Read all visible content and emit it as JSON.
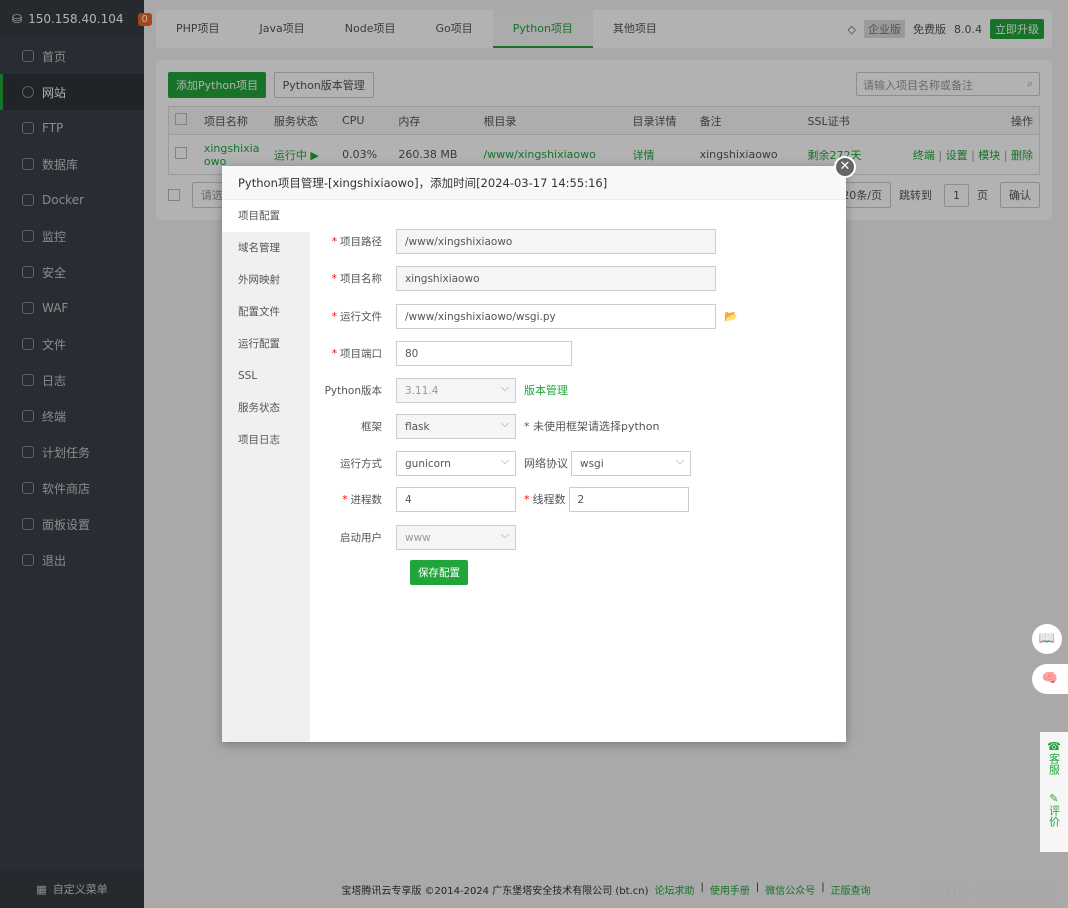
{
  "sidebar": {
    "ip": "150.158.40.104",
    "badge": "0",
    "items": [
      {
        "label": "首页",
        "icon": "home-icon"
      },
      {
        "label": "网站",
        "icon": "globe-icon",
        "active": true
      },
      {
        "label": "FTP",
        "icon": "ftp-icon"
      },
      {
        "label": "数据库",
        "icon": "database-icon"
      },
      {
        "label": "Docker",
        "icon": "docker-icon"
      },
      {
        "label": "监控",
        "icon": "monitor-icon"
      },
      {
        "label": "安全",
        "icon": "shield-icon"
      },
      {
        "label": "WAF",
        "icon": "waf-icon"
      },
      {
        "label": "文件",
        "icon": "folder-icon"
      },
      {
        "label": "日志",
        "icon": "log-icon"
      },
      {
        "label": "终端",
        "icon": "terminal-icon"
      },
      {
        "label": "计划任务",
        "icon": "calendar-icon"
      },
      {
        "label": "软件商店",
        "icon": "store-icon"
      },
      {
        "label": "面板设置",
        "icon": "gear-icon"
      },
      {
        "label": "退出",
        "icon": "logout-icon"
      }
    ],
    "footer": "自定义菜单"
  },
  "topbar": {
    "tabs": [
      "PHP项目",
      "Java项目",
      "Node项目",
      "Go项目",
      "Python项目",
      "其他项目"
    ],
    "active_tab": 4,
    "enterprise": "企业版",
    "edition": "免费版",
    "version": "8.0.4",
    "upgrade": "立即升级"
  },
  "panel": {
    "add_button": "添加Python项目",
    "version_button": "Python版本管理",
    "search_placeholder": "请输入项目名称或备注",
    "columns": [
      "项目名称",
      "服务状态",
      "CPU",
      "内存",
      "根目录",
      "目录详情",
      "备注",
      "SSL证书",
      "操作"
    ],
    "row": {
      "name": "xingshixiaowo",
      "status": "运行中 ▶",
      "cpu": "0.03%",
      "memory": "260.38 MB",
      "root": "/www/xingshixiaowo",
      "detail": "详情",
      "note": "xingshixiaowo",
      "ssl": "剩余272天",
      "actions": [
        "终端",
        "设置",
        "模块",
        "删除"
      ]
    },
    "batch_placeholder": "请选",
    "page_size": "20条/页",
    "jump_label": "跳转到",
    "page": "1",
    "page_unit": "页",
    "confirm": "确认"
  },
  "modal": {
    "title": "Python项目管理-[xingshixiaowo]，添加时间[2024-03-17 14:55:16]",
    "nav": [
      "项目配置",
      "域名管理",
      "外网映射",
      "配置文件",
      "运行配置",
      "SSL",
      "服务状态",
      "项目日志"
    ],
    "active_nav": 0,
    "form": {
      "path_label": "项目路径",
      "path": "/www/xingshixiaowo",
      "name_label": "项目名称",
      "name": "xingshixiaowo",
      "run_file_label": "运行文件",
      "run_file": "/www/xingshixiaowo/wsgi.py",
      "port_label": "项目端口",
      "port": "80",
      "pyver_label": "Python版本",
      "pyver": "3.11.4",
      "pyver_link": "版本管理",
      "framework_label": "框架",
      "framework": "flask",
      "framework_hint": "* 未使用框架请选择python",
      "run_mode_label": "运行方式",
      "run_mode": "gunicorn",
      "protocol_label": "网络协议",
      "protocol": "wsgi",
      "procs_label": "进程数",
      "procs": "4",
      "threads_label": "线程数",
      "threads": "2",
      "user_label": "启动用户",
      "user": "www",
      "save": "保存配置"
    }
  },
  "footer": {
    "text": "宝塔腾讯云专享版 ©2014-2024 广东堡塔安全技术有限公司 (bt.cn)",
    "links": [
      "论坛求助",
      "使用手册",
      "微信公众号",
      "正版查询"
    ],
    "watermark": "CSDN @星石传说"
  },
  "side": {
    "service": "客服",
    "review": "评价"
  }
}
